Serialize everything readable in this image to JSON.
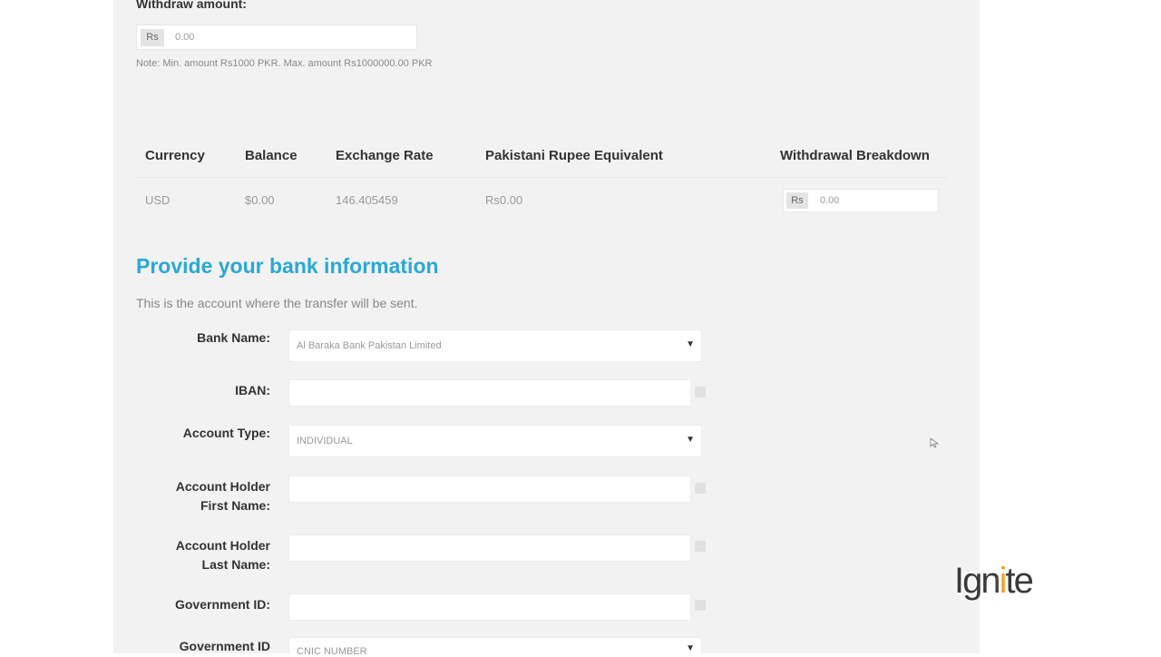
{
  "withdraw": {
    "label": "Withdraw amount:",
    "prefix": "Rs",
    "value": "0.00",
    "note": "Note: Min. amount Rs1000 PKR. Max. amount Rs1000000.00 PKR"
  },
  "table": {
    "headers": [
      "Currency",
      "Balance",
      "Exchange Rate",
      "Pakistani Rupee Equivalent",
      "Withdrawal Breakdown"
    ],
    "rows": [
      {
        "currency": "USD",
        "balance": "$0.00",
        "rate": "146.405459",
        "equivalent": "Rs0.00",
        "breakdown_prefix": "Rs",
        "breakdown_value": "0.00"
      }
    ]
  },
  "bank": {
    "title": "Provide your bank information",
    "subtitle": "This is the account where the transfer will be sent.",
    "fields": {
      "bank_name": {
        "label": "Bank Name:",
        "value": "Al Baraka Bank Pakistan Limited"
      },
      "iban": {
        "label": "IBAN:"
      },
      "account_type": {
        "label": "Account Type:",
        "value": "INDIVIDUAL"
      },
      "first_name": {
        "label_line1": "Account Holder",
        "label_line2": "First Name:"
      },
      "last_name": {
        "label_line1": "Account Holder",
        "label_line2": "Last Name:"
      },
      "gov_id": {
        "label": "Government ID:"
      },
      "gov_id_type": {
        "label": "Government ID",
        "value": "CNIC NUMBER"
      }
    }
  },
  "branding": {
    "logo_part1": "Ign",
    "logo_accent": "i",
    "logo_part2": "te",
    "accent_color": "#f29c1f",
    "title_color": "#29a8d6"
  }
}
